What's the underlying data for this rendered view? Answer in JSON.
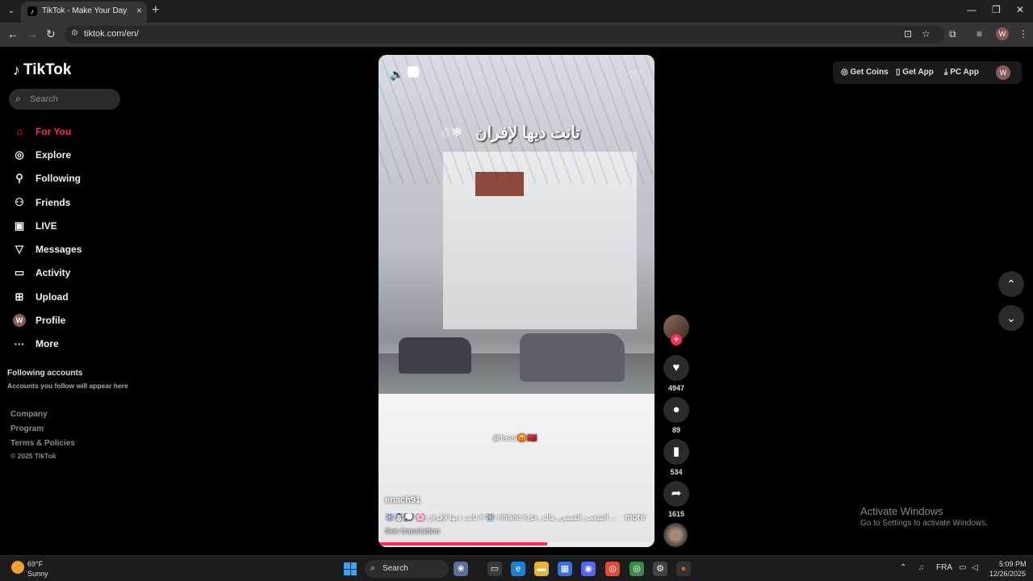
{
  "browser": {
    "tab_title": "TikTok - Make Your Day",
    "url": "tiktok.com/en/",
    "profile_initial": "W"
  },
  "tiktok": {
    "logo": "TikTok",
    "search_placeholder": "Search",
    "accent": "#fe2c55",
    "nav": [
      {
        "label": "For You",
        "icon": "home-icon",
        "active": true
      },
      {
        "label": "Explore",
        "icon": "compass-icon"
      },
      {
        "label": "Following",
        "icon": "person-icon"
      },
      {
        "label": "Friends",
        "icon": "friends-icon"
      },
      {
        "label": "LIVE",
        "icon": "live-icon"
      },
      {
        "label": "Messages",
        "icon": "send-icon"
      },
      {
        "label": "Activity",
        "icon": "message-square-icon"
      },
      {
        "label": "Upload",
        "icon": "plus-square-icon"
      },
      {
        "label": "Profile",
        "icon": "avatar-icon"
      },
      {
        "label": "More",
        "icon": "more-icon"
      }
    ],
    "following_title": "Following accounts",
    "following_sub": "Accounts you follow will appear here",
    "footer": [
      "Company",
      "Program",
      "Terms & Policies"
    ],
    "copyright": "© 2025 TikTok",
    "video": {
      "overlay_caption": "تانت ديها لإفران",
      "overlay_tag": "@fassi😡🇲🇦",
      "author": "enach91",
      "description": "❄️☃️💭 🌸 تانت ديها لإفران # ❄️ #ifrane #الشعب_الصيني_ماله_حل ...",
      "more_label": "more",
      "see_translation": "See translation",
      "progress": 0.61
    },
    "actions": {
      "likes": "4947",
      "comments": "89",
      "saves": "534",
      "shares": "1615"
    },
    "top_right": {
      "get_coins": "Get Coins",
      "get_app": "Get App",
      "pc_app": "PC App",
      "avatar_initial": "W"
    }
  },
  "windows": {
    "activate_title": "Activate Windows",
    "activate_sub": "Go to Settings to activate Windows.",
    "weather_temp": "69°F",
    "weather_desc": "Sunny",
    "search_label": "Search",
    "language": "FRA",
    "time": "5:09 PM",
    "date": "12/26/2025"
  }
}
